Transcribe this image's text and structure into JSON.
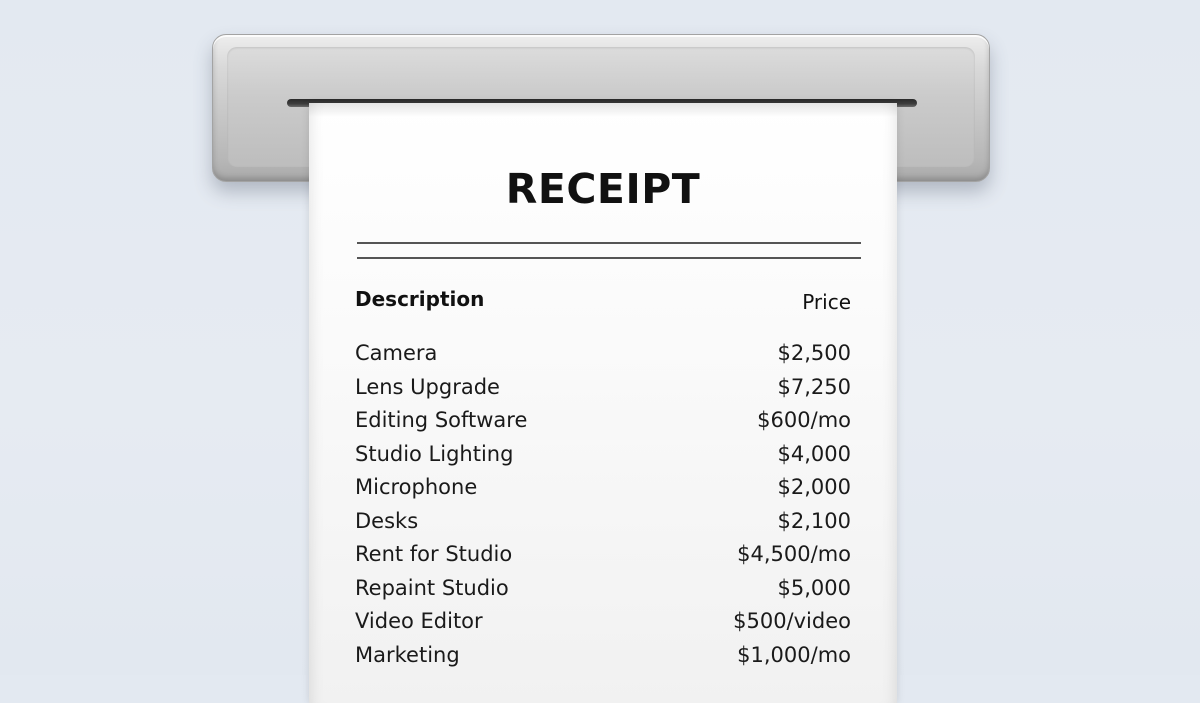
{
  "receipt": {
    "title": "RECEIPT",
    "header": {
      "description": "Description",
      "price": "Price"
    },
    "items": [
      {
        "description": "Camera",
        "price": "$2,500"
      },
      {
        "description": "Lens Upgrade",
        "price": "$7,250"
      },
      {
        "description": "Editing Software",
        "price": "$600/mo"
      },
      {
        "description": "Studio Lighting",
        "price": "$4,000"
      },
      {
        "description": "Microphone",
        "price": "$2,000"
      },
      {
        "description": "Desks",
        "price": "$2,100"
      },
      {
        "description": "Rent for Studio",
        "price": "$4,500/mo"
      },
      {
        "description": "Repaint Studio",
        "price": "$5,000"
      },
      {
        "description": "Video Editor",
        "price": "$500/video"
      },
      {
        "description": "Marketing",
        "price": "$1,000/mo"
      }
    ]
  },
  "colors": {
    "background": "#e4eaf1",
    "printer": "#c7c7c7",
    "paper": "#ffffff",
    "text": "#111111"
  }
}
